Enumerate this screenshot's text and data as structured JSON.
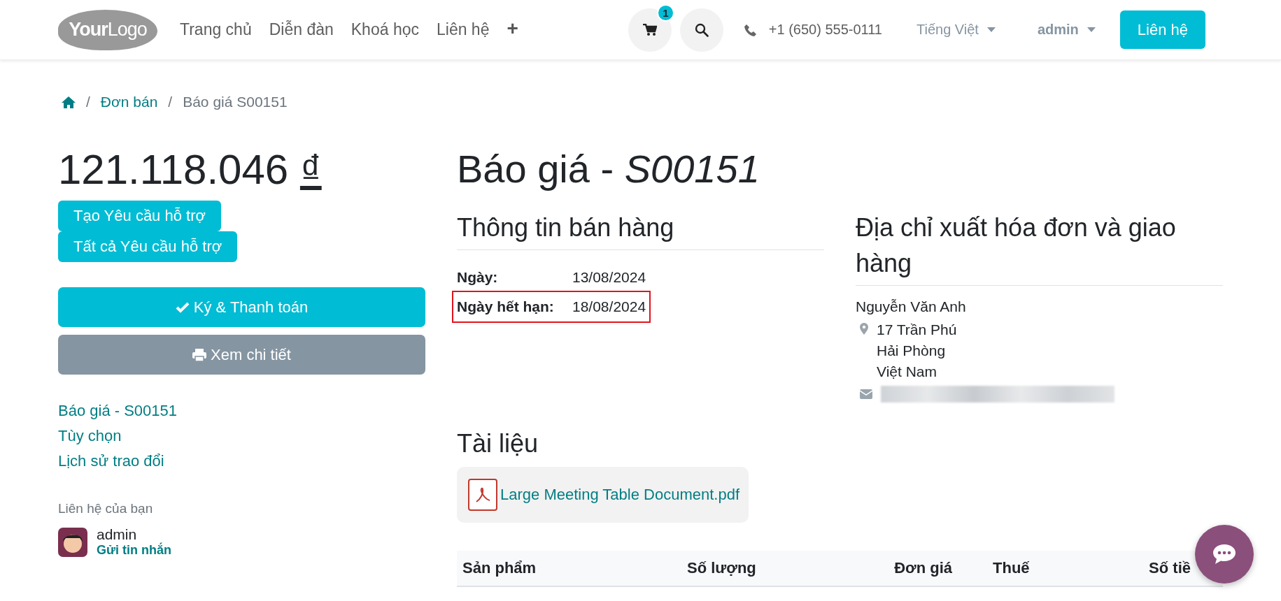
{
  "header": {
    "logo": {
      "bold": "Your",
      "light": "Logo"
    },
    "nav": [
      {
        "label": "Trang chủ"
      },
      {
        "label": "Diễn đàn"
      },
      {
        "label": "Khoá học"
      },
      {
        "label": "Liên hệ"
      },
      {
        "label": "+",
        "kind": "plus"
      }
    ],
    "cart_count": "1",
    "phone": "+1 (650) 555-0111",
    "language": "Tiếng Việt",
    "user": "admin",
    "cta": "Liên hệ"
  },
  "breadcrumb": [
    {
      "separator": "/",
      "label": "Đơn bán",
      "kind": "link"
    },
    {
      "separator": "/",
      "label": "Báo giá S00151",
      "kind": "current"
    }
  ],
  "sidebar": {
    "amount": "121.118.046",
    "currency": "₫",
    "ticket_buttons": [
      "Tạo Yêu cầu hỗ trợ",
      "Tất cả Yêu cầu hỗ trợ"
    ],
    "actions": [
      {
        "label": "Ký & Thanh toán",
        "kind": "primary"
      },
      {
        "label": "Xem chi tiết",
        "kind": "secondary"
      }
    ],
    "links": [
      "Báo giá - S00151",
      "Tùy chọn",
      "Lịch sử trao đổi"
    ],
    "contact_heading": "Liên hệ của bạn",
    "contact_name": "admin",
    "contact_action": "Gửi tin nhắn"
  },
  "document": {
    "title_prefix": "Báo giá - ",
    "title_number": "S00151",
    "sales_info": {
      "heading": "Thông tin bán hàng",
      "rows": [
        {
          "label": "Ngày:",
          "value": "13/08/2024",
          "highlighted": false
        },
        {
          "label": "Ngày hết hạn:",
          "value": "18/08/2024",
          "highlighted": true
        }
      ]
    },
    "address": {
      "heading": "Địa chỉ xuất hóa đơn và giao hàng",
      "name": "Nguyễn Văn Anh",
      "lines": [
        "17 Trần Phú",
        "Hải Phòng",
        "Việt Nam"
      ],
      "email_blurred": true
    },
    "attachments": {
      "heading": "Tài liệu",
      "files": [
        "Large Meeting Table Document.pdf"
      ]
    },
    "table": {
      "columns": [
        {
          "label": "Sản phẩm"
        },
        {
          "label": "Số lượng"
        },
        {
          "label": "Đơn giá"
        },
        {
          "label": "Thuế"
        },
        {
          "label": "Số tiề"
        }
      ]
    }
  }
}
